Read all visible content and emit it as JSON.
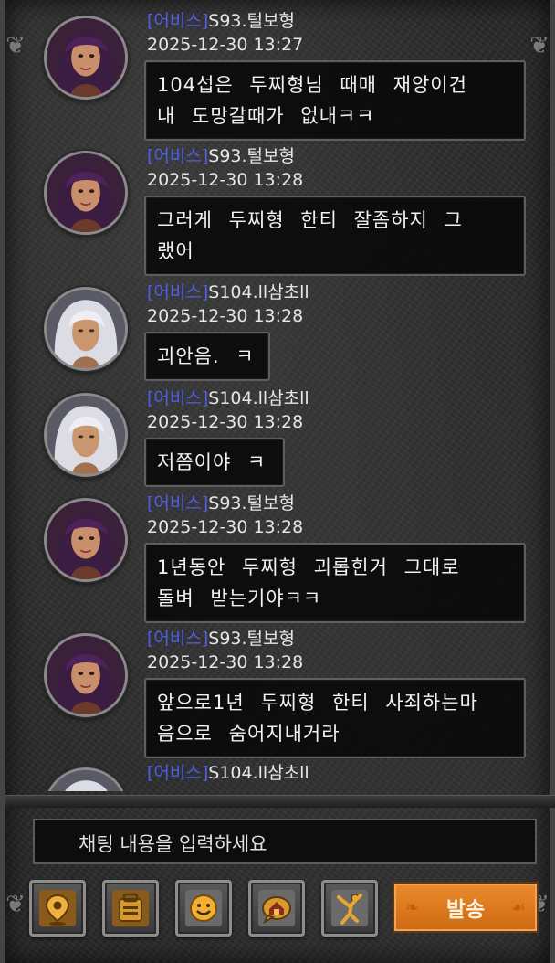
{
  "messages": [
    {
      "guild": "[어비스]",
      "name": "S93.털보형",
      "time": "2025-12-30 13:27",
      "lines": [
        "104섭은 두찌형님 때매 재앙이건",
        "내 도망갈때가 없내ㅋㅋ"
      ],
      "avatar": "female-purple-hair-avatar"
    },
    {
      "guild": "[어비스]",
      "name": "S93.털보형",
      "time": "2025-12-30 13:28",
      "lines": [
        "그러게 두찌형 한티 잘좀하지 그",
        "랬어"
      ],
      "avatar": "female-purple-hair-avatar"
    },
    {
      "guild": "[어비스]",
      "name": "S104.ll삼초ll",
      "time": "2025-12-30 13:28",
      "lines": [
        "괴안음. ㅋ"
      ],
      "avatar": "male-white-hair-avatar"
    },
    {
      "guild": "[어비스]",
      "name": "S104.ll삼초ll",
      "time": "2025-12-30 13:28",
      "lines": [
        "저쯤이야 ㅋ"
      ],
      "avatar": "male-white-hair-avatar"
    },
    {
      "guild": "[어비스]",
      "name": "S93.털보형",
      "time": "2025-12-30 13:28",
      "lines": [
        "1년동안 두찌형 괴롭힌거 그대로",
        "돌벼 받는기야ㅋㅋ"
      ],
      "avatar": "female-purple-hair-avatar"
    },
    {
      "guild": "[어비스]",
      "name": "S93.털보형",
      "time": "2025-12-30 13:28",
      "lines": [
        "앞으로1년 두찌형 한티 사죄하는마",
        "음으로 숨어지내거라"
      ],
      "avatar": "female-purple-hair-avatar"
    },
    {
      "guild": "[어비스]",
      "name": "S104.ll삼초ll",
      "time": "",
      "lines": [],
      "avatar": "male-white-hair-avatar"
    }
  ],
  "input": {
    "placeholder": "채팅 내용을 입력하세요"
  },
  "toolbar": {
    "buttons": [
      "location-pin-icon",
      "inventory-bag-icon",
      "smiley-emoji-icon",
      "home-chat-icon",
      "character-pose-icon"
    ],
    "send_label": "발송"
  },
  "colors": {
    "guild": "#4f5fe8",
    "send_button": "#e07a20",
    "bubble_border": "#5e5e5e"
  }
}
